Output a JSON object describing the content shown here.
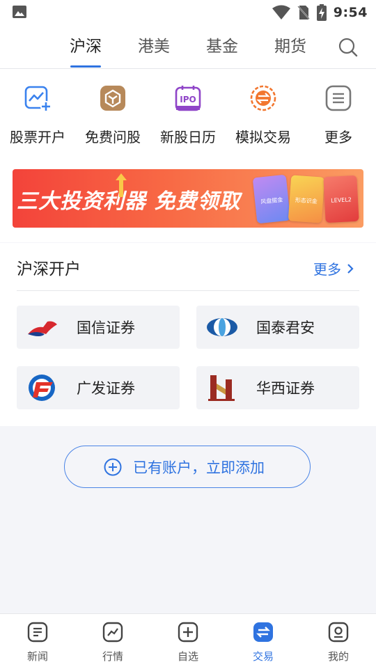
{
  "status_bar": {
    "time": "9:54"
  },
  "top_tabs": [
    {
      "label": "沪深"
    },
    {
      "label": "港美"
    },
    {
      "label": "基金"
    },
    {
      "label": "期货"
    }
  ],
  "quick_actions": [
    {
      "label": "股票开户",
      "icon": "stock-open-icon"
    },
    {
      "label": "免费问股",
      "icon": "free-ask-icon"
    },
    {
      "label": "新股日历",
      "icon": "ipo-calendar-icon"
    },
    {
      "label": "模拟交易",
      "icon": "simulated-trade-icon"
    },
    {
      "label": "更多",
      "icon": "more-icon"
    }
  ],
  "banner": {
    "title": "三大投资利器 免费领取",
    "cards": [
      {
        "label": "风盘掘金"
      },
      {
        "label": "形态识金"
      },
      {
        "label": "LEVEL2"
      }
    ]
  },
  "account_section": {
    "title": "沪深开户",
    "more": "更多",
    "brokers": [
      {
        "name": "国信证券"
      },
      {
        "name": "国泰君安"
      },
      {
        "name": "广发证券"
      },
      {
        "name": "华西证券"
      }
    ]
  },
  "add_account": {
    "label": "已有账户，立即添加"
  },
  "bottom_nav": [
    {
      "label": "新闻"
    },
    {
      "label": "行情"
    },
    {
      "label": "自选"
    },
    {
      "label": "交易"
    },
    {
      "label": "我的"
    }
  ],
  "colors": {
    "accent": "#2f73e0",
    "banner_start": "#f3433a",
    "banner_end": "#fb9c62"
  }
}
